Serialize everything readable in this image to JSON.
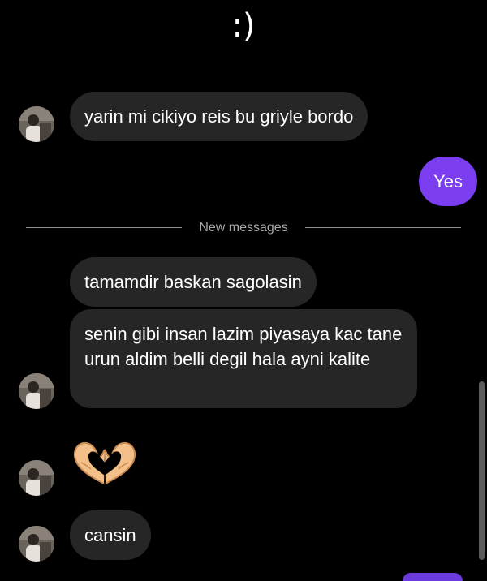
{
  "header": {
    "emoticon": ":)"
  },
  "messages": {
    "m1": {
      "text": "yarin mi cikiyo reis bu griyle bordo"
    },
    "m2": {
      "text": "Yes"
    },
    "m3": {
      "text": "tamamdir baskan sagolasin"
    },
    "m4": {
      "text": "senin gibi insan lazim piyasaya kac tane urun aldim belli degil hala ayni kalite"
    },
    "m5": {
      "emoji": "heart-hands"
    },
    "m6": {
      "text": "cansin"
    }
  },
  "divider": {
    "label": "New messages"
  },
  "colors": {
    "background": "#000000",
    "incoming_bubble": "#262626",
    "outgoing_bubble": "#7a3df0",
    "divider_text": "#a8a8a8",
    "text": "#ffffff"
  }
}
